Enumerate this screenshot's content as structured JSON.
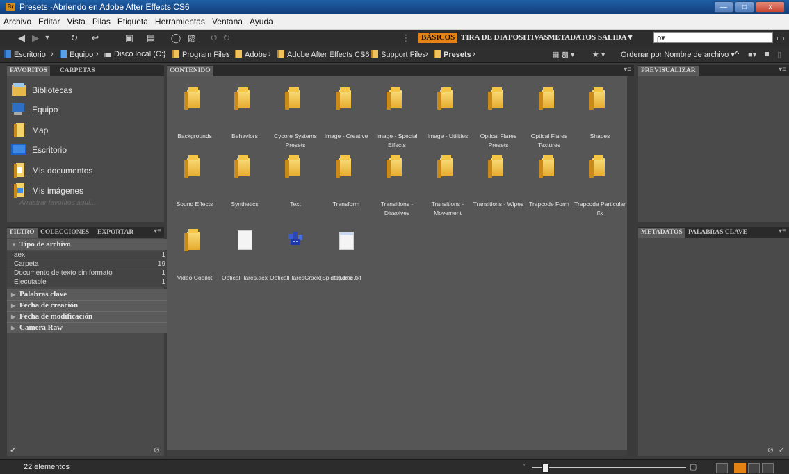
{
  "window": {
    "title": "Presets -Abriendo en Adobe After Effects CS6",
    "app_badge": "Br",
    "controls": {
      "minimize": "—",
      "maximize": "□",
      "close": "x"
    }
  },
  "menu": [
    "Archivo",
    "Editar",
    "Vista",
    "Pilas",
    "Etiqueta",
    "Herramientas",
    "Ventana",
    "Ayuda"
  ],
  "toolbar": {
    "workspaces": [
      "BÁSICOS",
      "TIRA DE DIAPOSITIVAS",
      "METADATOS",
      "SALIDA ▾"
    ],
    "active_workspace": "BÁSICOS",
    "search_placeholder": "ρ▾"
  },
  "path": {
    "crumbs": [
      "Escritorio",
      "Equipo",
      "Disco local (C:)",
      "Program Files",
      "Adobe",
      "Adobe After Effects CS6",
      "Support Files",
      "Presets"
    ],
    "sort_label": "Ordenar por Nombre de archivo ▾"
  },
  "favorites_panel": {
    "tabs": [
      "FAVORITOS",
      "CARPETAS"
    ],
    "items": [
      "Bibliotecas",
      "Equipo",
      "Map",
      "Escritorio",
      "Mis documentos",
      "Mis imágenes"
    ],
    "drag_hint": "Arrastrar favoritos aquí..."
  },
  "filter_panel": {
    "tabs": [
      "FILTRO",
      "COLECCIONES",
      "EXPORTAR"
    ],
    "sections": {
      "file_type": "Tipo de archivo",
      "keywords": "Palabras clave",
      "created": "Fecha de creación",
      "modified": "Fecha de modificación",
      "camera": "Camera Raw"
    },
    "file_types": [
      {
        "label": "aex",
        "count": "1"
      },
      {
        "label": "Carpeta",
        "count": "19"
      },
      {
        "label": "Documento de texto sin formato",
        "count": "1"
      },
      {
        "label": "Ejecutable",
        "count": "1"
      }
    ]
  },
  "content_panel": {
    "tab": "CONTENIDO",
    "items": [
      {
        "type": "folder",
        "name": "Backgrounds"
      },
      {
        "type": "folder",
        "name": "Behaviors"
      },
      {
        "type": "folder",
        "name": "Cycore Systems Presets"
      },
      {
        "type": "folder",
        "name": "Image - Creative"
      },
      {
        "type": "folder",
        "name": "Image - Special Effects"
      },
      {
        "type": "folder",
        "name": "Image - Utilities"
      },
      {
        "type": "folder",
        "name": "Optical Flares Presets"
      },
      {
        "type": "folder",
        "name": "Optical Flares Textures"
      },
      {
        "type": "folder",
        "name": "Shapes"
      },
      {
        "type": "folder",
        "name": "Sound Effects"
      },
      {
        "type": "folder",
        "name": "Synthetics"
      },
      {
        "type": "folder",
        "name": "Text"
      },
      {
        "type": "folder",
        "name": "Transform"
      },
      {
        "type": "folder",
        "name": "Transitions - Dissolves"
      },
      {
        "type": "folder",
        "name": "Transitions - Movement"
      },
      {
        "type": "folder",
        "name": "Transitions - Wipes"
      },
      {
        "type": "folder",
        "name": "Trapcode Form"
      },
      {
        "type": "folder",
        "name": "Trapcode Particular ffx"
      },
      {
        "type": "folder",
        "name": "Video Copilot"
      },
      {
        "type": "doc",
        "name": "OpticalFlares.aex"
      },
      {
        "type": "exe",
        "name": "OpticalFlaresCrack(Spider).exe"
      },
      {
        "type": "txt",
        "name": "Readme.txt"
      }
    ]
  },
  "preview_panel": {
    "tab": "PREVISUALIZAR"
  },
  "metadata_panel": {
    "tabs": [
      "METADATOS",
      "PALABRAS CLAVE"
    ]
  },
  "status": {
    "count": "22 elementos"
  }
}
